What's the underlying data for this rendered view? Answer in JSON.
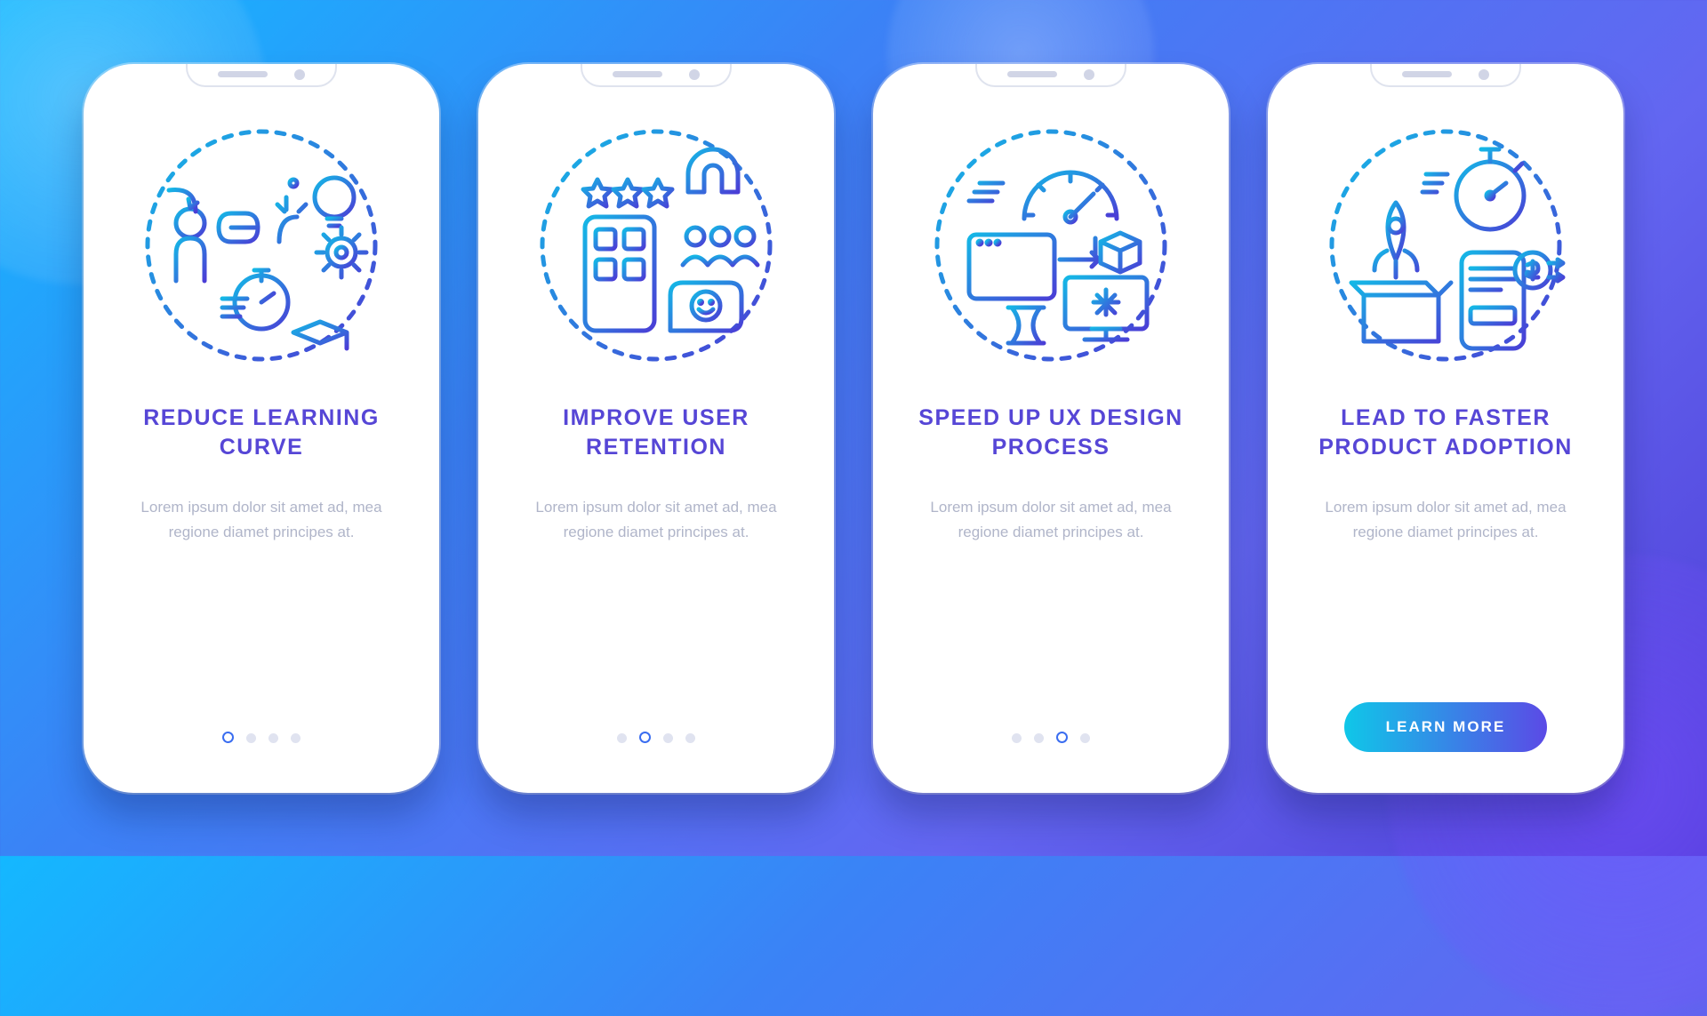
{
  "body_text": "Lorem ipsum dolor sit amet ad, mea regione diamet principes at.",
  "cta_label": "LEARN MORE",
  "screens": [
    {
      "title": "REDUCE LEARNING CURVE",
      "icon": "learning-curve-icon",
      "active_dot": 0
    },
    {
      "title": "IMPROVE USER RETENTION",
      "icon": "user-retention-icon",
      "active_dot": 1
    },
    {
      "title": "SPEED UP UX DESIGN PROCESS",
      "icon": "speed-ux-icon",
      "active_dot": 2
    },
    {
      "title": "LEAD TO FASTER PRODUCT ADOPTION",
      "icon": "product-adoption-icon",
      "active_dot": 3
    }
  ],
  "colors": {
    "accent": "#5646d6",
    "gradient_a": "#0fc7e8",
    "gradient_b": "#5b4ae6"
  }
}
